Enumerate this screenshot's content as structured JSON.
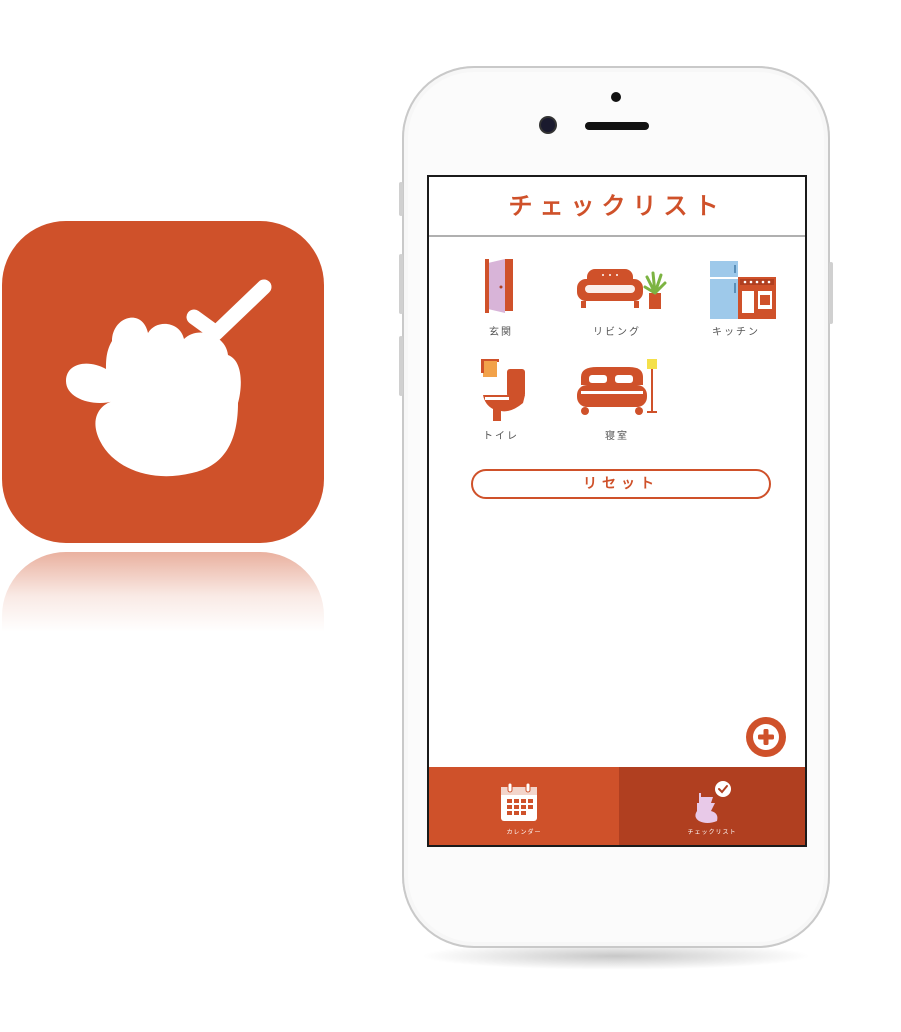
{
  "app_icon": {
    "name": "hand-check-app-icon",
    "color": "#cf512a"
  },
  "screen": {
    "title": "チェックリスト",
    "rooms": [
      {
        "label": "玄関",
        "icon": "door-icon"
      },
      {
        "label": "リビング",
        "icon": "sofa-icon"
      },
      {
        "label": "キッチン",
        "icon": "kitchen-icon"
      },
      {
        "label": "トイレ",
        "icon": "toilet-icon"
      },
      {
        "label": "寝室",
        "icon": "bed-icon"
      }
    ],
    "reset_label": "リセット",
    "fab_icon": "plus-icon",
    "tabs": [
      {
        "label": "カレンダー",
        "icon": "calendar-icon",
        "active": false
      },
      {
        "label": "チェックリスト",
        "icon": "hand-check-icon",
        "active": true
      }
    ]
  },
  "colors": {
    "accent": "#cf512a",
    "accent_dark": "#b03f20",
    "door_pink": "#d8b4d8",
    "fridge_blue": "#9ec9ea",
    "lamp_yellow": "#f4e04a",
    "plant_green": "#7cb342"
  }
}
